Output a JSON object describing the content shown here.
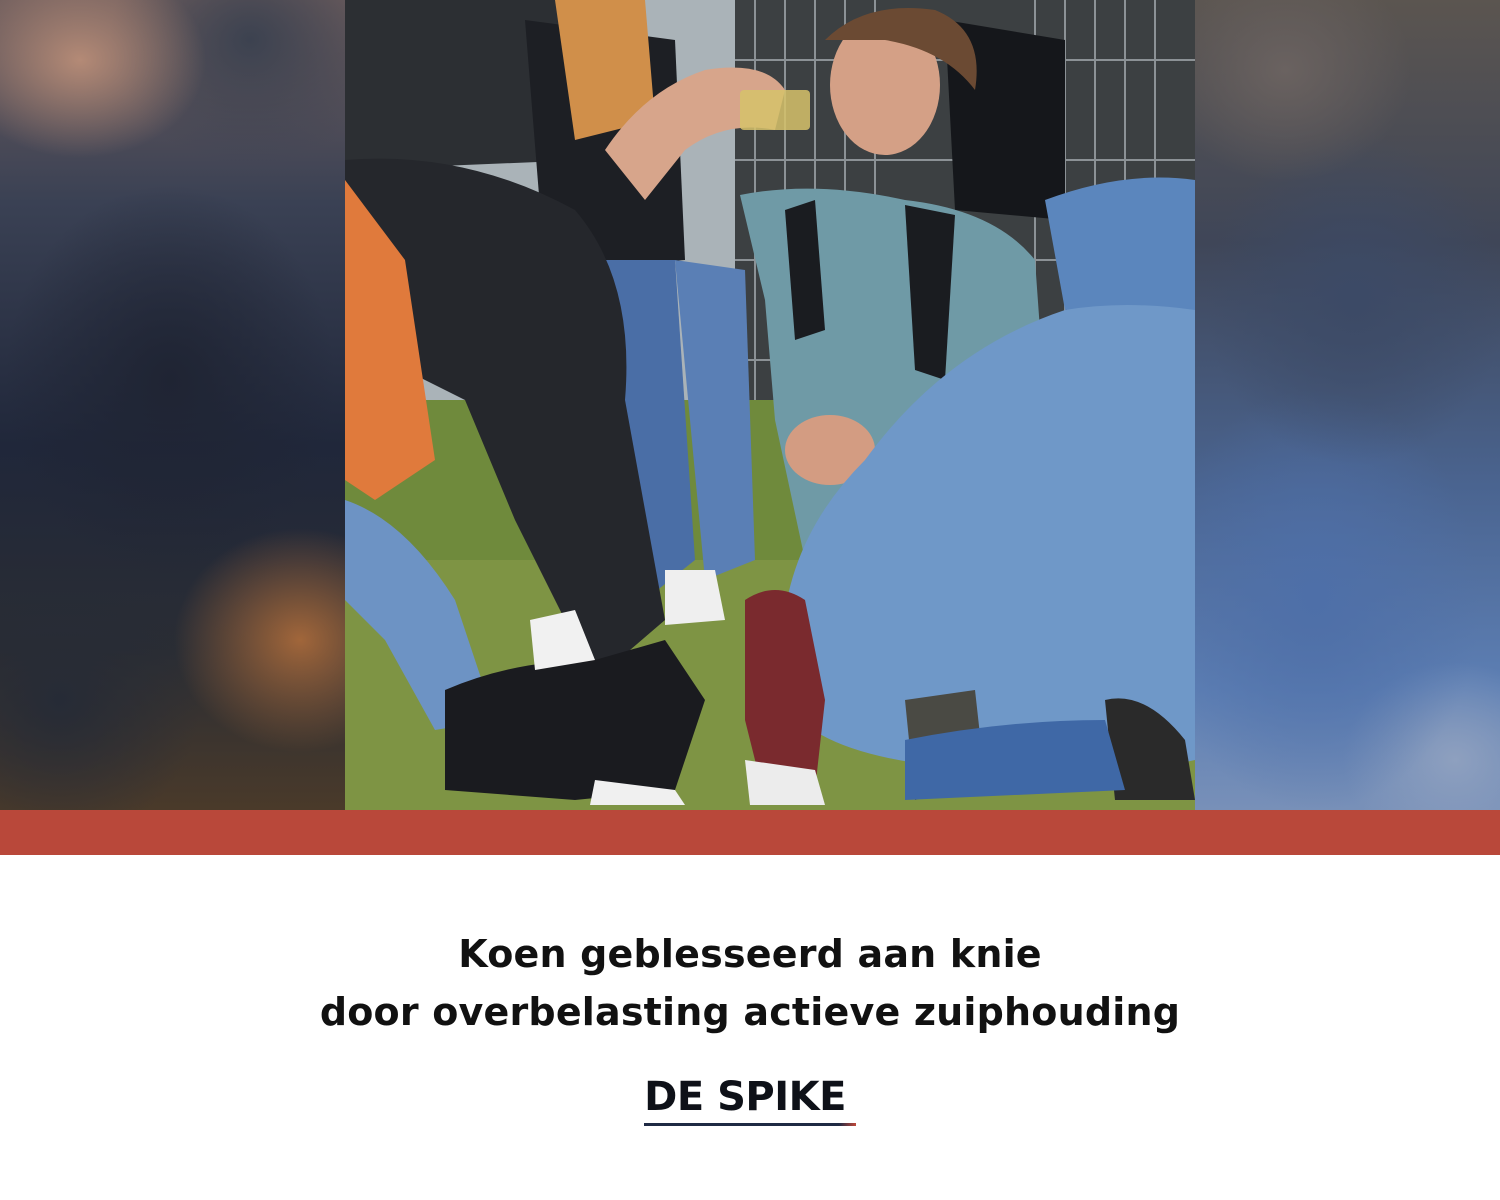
{
  "caption": {
    "line1": "Koen geblesseerd aan knie",
    "line2": "door overbelasting actieve zuiphouding"
  },
  "brand": {
    "name": "DE SPIKE"
  },
  "colors": {
    "accent_bar": "#b9483a",
    "text": "#111111",
    "brand_underline": "#1f2a44",
    "background": "#ffffff"
  }
}
